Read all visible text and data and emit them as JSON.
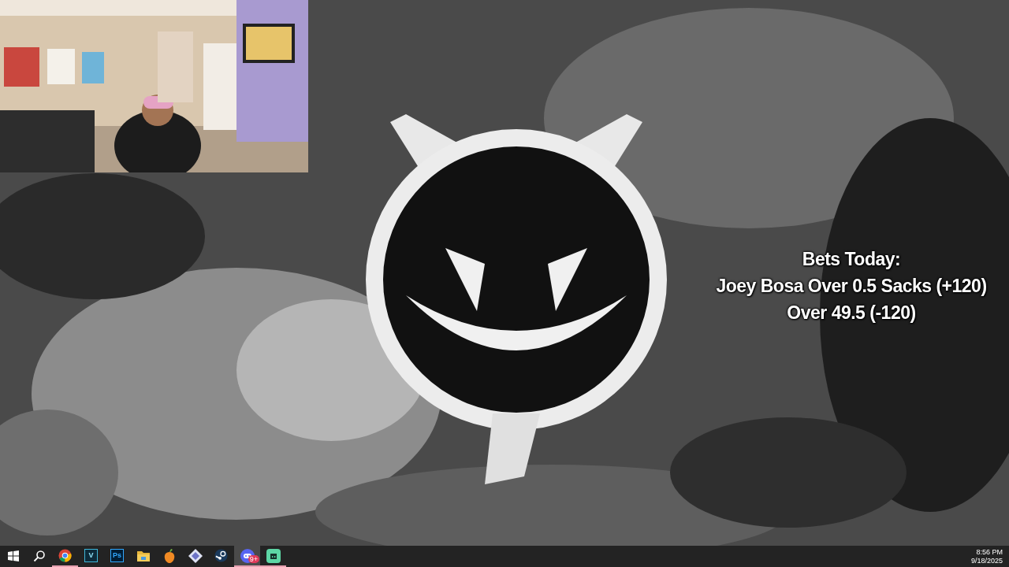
{
  "overlay": {
    "lines": [
      "Bets Today:",
      "Joey Bosa Over 0.5 Sacks (+120)",
      "Over 49.5 (-120)"
    ]
  },
  "taskbar": {
    "items": [
      {
        "kind": "start",
        "running": false,
        "selected": false
      },
      {
        "kind": "search",
        "running": false,
        "selected": false
      },
      {
        "kind": "browser",
        "running": true,
        "selected": false
      },
      {
        "kind": "letter",
        "glyph": "V",
        "running": false,
        "selected": false
      },
      {
        "kind": "letter2",
        "glyph": "Ps",
        "running": false,
        "selected": false
      },
      {
        "kind": "folder",
        "running": false,
        "selected": false
      },
      {
        "kind": "fruit",
        "running": false,
        "selected": false
      },
      {
        "kind": "diamond",
        "running": false,
        "selected": false
      },
      {
        "kind": "steam",
        "running": false,
        "selected": false
      },
      {
        "kind": "chat",
        "badge": "9+",
        "running": true,
        "selected": true
      },
      {
        "kind": "bot",
        "running": true,
        "selected": false
      }
    ],
    "clock": {
      "time": "8:56 PM",
      "date": "9/18/2025"
    }
  }
}
